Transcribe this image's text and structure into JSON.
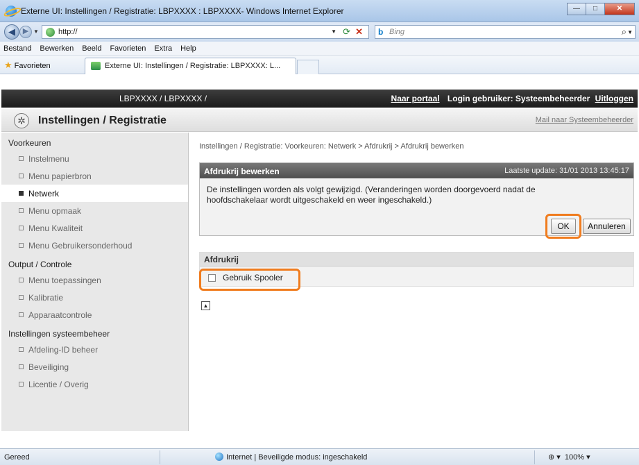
{
  "browser": {
    "window_title": "Externe UI: Instellingen / Registratie: LBPXXXX : LBPXXXX- Windows Internet Explorer",
    "url": "http://",
    "search_placeholder": "Bing",
    "menu": [
      "Bestand",
      "Bewerken",
      "Beeld",
      "Favorieten",
      "Extra",
      "Help"
    ],
    "favorites_label": "Favorieten",
    "tab_label": "Externe UI: Instellingen / Registratie: LBPXXXX: L...",
    "status_text": "Gereed",
    "zone_text": "Internet | Beveiligde modus: ingeschakeld",
    "zoom": "100%"
  },
  "header": {
    "model": "LBPXXXX / LBPXXXX /",
    "portal_link": "Naar portaal",
    "login_text": "Login gebruiker: Systeembeheerder",
    "logout_link": "Uitloggen"
  },
  "page": {
    "title": "Instellingen / Registratie",
    "mail_link": "Mail naar Systeembeheerder",
    "breadcrumb": "Instellingen / Registratie: Voorkeuren: Netwerk > Afdrukrij > Afdrukrij bewerken"
  },
  "sidebar": {
    "sections": [
      {
        "label": "Voorkeuren",
        "items": [
          "Instelmenu",
          "Menu papierbron",
          "Netwerk",
          "Menu opmaak",
          "Menu Kwaliteit",
          "Menu Gebruikersonderhoud"
        ]
      },
      {
        "label": "Output / Controle",
        "items": [
          "Menu toepassingen",
          "Kalibratie",
          "Apparaatcontrole"
        ]
      },
      {
        "label": "Instellingen systeembeheer",
        "items": [
          "Afdeling-ID beheer",
          "Beveiliging",
          "Licentie / Overig"
        ]
      }
    ],
    "active_item": "Netwerk"
  },
  "panel": {
    "title": "Afdrukrij bewerken",
    "last_update": "Laatste update: 31/01 2013 13:45:17",
    "message": "De instellingen worden als volgt gewijzigd. (Veranderingen worden doorgevoerd nadat de hoofdschakelaar wordt uitgeschakeld en weer ingeschakeld.)",
    "ok_label": "OK",
    "cancel_label": "Annuleren"
  },
  "section": {
    "title": "Afdrukrij",
    "checkbox_label": "Gebruik Spooler",
    "checkbox_checked": false
  },
  "colors": {
    "highlight": "#f07c1e",
    "header_bg": "#2a2a2a",
    "panel_head": "#606060"
  }
}
